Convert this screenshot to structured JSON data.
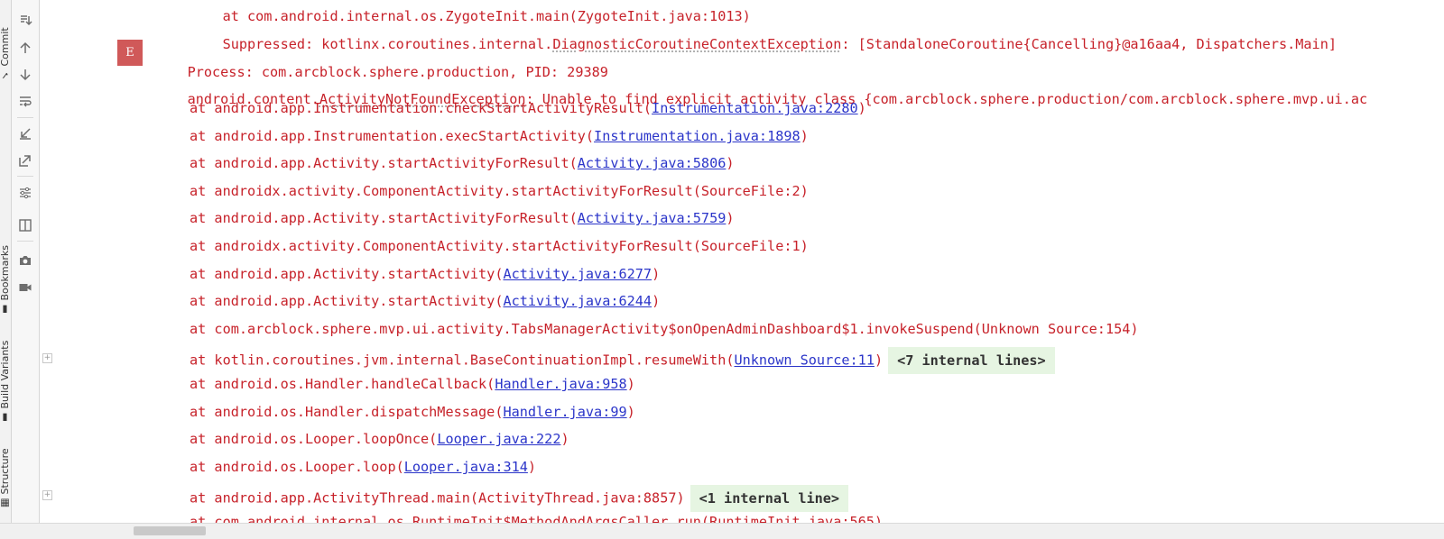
{
  "side_tabs": [
    {
      "label": "Commit",
      "icon": "commit-icon"
    },
    {
      "label": "Bookmarks",
      "icon": "bookmark-icon"
    },
    {
      "label": "Build Variants",
      "icon": "build-variants-icon"
    },
    {
      "label": "Structure",
      "icon": "structure-icon"
    }
  ],
  "toolbar": [
    {
      "name": "scroll-to-end-icon"
    },
    {
      "name": "up-arrow-icon"
    },
    {
      "name": "down-arrow-icon"
    },
    {
      "name": "soft-wrap-icon"
    },
    {
      "name": "import-icon"
    },
    {
      "name": "export-icon"
    },
    {
      "name": "filter-settings-icon"
    },
    {
      "name": "split-view-icon"
    },
    {
      "name": "camera-icon"
    },
    {
      "name": "video-icon"
    }
  ],
  "log": {
    "top_line": "at com.android.internal.os.ZygoteInit.main(ZygoteInit.java:1013)",
    "suppressed_prefix": "Suppressed: kotlinx.coroutines.internal.",
    "suppressed_class": "DiagnosticCoroutineContextException",
    "suppressed_suffix": ": [StandaloneCoroutine{Cancelling}@a16aa4, Dispatchers.Main]",
    "level_badge": "E",
    "process_line": "Process: com.arcblock.sphere.production, PID: 29389",
    "exception_prefix": "android.content.",
    "exception_class": "ActivityNotFoundException",
    "exception_suffix": ": Unable to find explicit activity class {com.arcblock.sphere.production/com.arcblock.sphere.mvp.ui.ac",
    "frames": [
      {
        "text": "at android.app.Instrumentation.checkStartActivityResult(",
        "link": "Instrumentation.java:2280",
        "close": ")"
      },
      {
        "text": "at android.app.Instrumentation.execStartActivity(",
        "link": "Instrumentation.java:1898",
        "close": ")"
      },
      {
        "text": "at android.app.Activity.startActivityForResult(",
        "link": "Activity.java:5806",
        "close": ")"
      },
      {
        "text": "at androidx.activity.ComponentActivity.startActivityForResult(SourceFile:2)",
        "link": "",
        "close": ""
      },
      {
        "text": "at android.app.Activity.startActivityForResult(",
        "link": "Activity.java:5759",
        "close": ")"
      },
      {
        "text": "at androidx.activity.ComponentActivity.startActivityForResult(SourceFile:1)",
        "link": "",
        "close": ""
      },
      {
        "text": "at android.app.Activity.startActivity(",
        "link": "Activity.java:6277",
        "close": ")"
      },
      {
        "text": "at android.app.Activity.startActivity(",
        "link": "Activity.java:6244",
        "close": ")"
      },
      {
        "text": "at com.arcblock.sphere.mvp.ui.activity.TabsManagerActivity$onOpenAdminDashboard$1.invokeSuspend(Unknown Source:154)",
        "link": "",
        "close": ""
      },
      {
        "text": "at kotlin.coroutines.jvm.internal.BaseContinuationImpl.resumeWith(",
        "link": "Unknown Source:11",
        "close": ")",
        "fold": "<7 internal lines>"
      },
      {
        "text": "at android.os.Handler.handleCallback(",
        "link": "Handler.java:958",
        "close": ")"
      },
      {
        "text": "at android.os.Handler.dispatchMessage(",
        "link": "Handler.java:99",
        "close": ")"
      },
      {
        "text": "at android.os.Looper.loopOnce(",
        "link": "Looper.java:222",
        "close": ")"
      },
      {
        "text": "at android.os.Looper.loop(",
        "link": "Looper.java:314",
        "close": ")"
      },
      {
        "text": "at android.app.ActivityThread.main(ActivityThread.java:8857)",
        "link": "",
        "close": "",
        "fold": "<1 internal line>"
      },
      {
        "text": "at com.android.internal.os.RuntimeInit$MethodAndArgsCaller.run(RuntimeInit.java:565)",
        "link": "",
        "close": ""
      }
    ]
  },
  "colors": {
    "error_text": "#c7222a",
    "link": "#2b35c9",
    "fold_badge_bg": "#e6f5e2",
    "level_badge_bg": "#d05959"
  }
}
